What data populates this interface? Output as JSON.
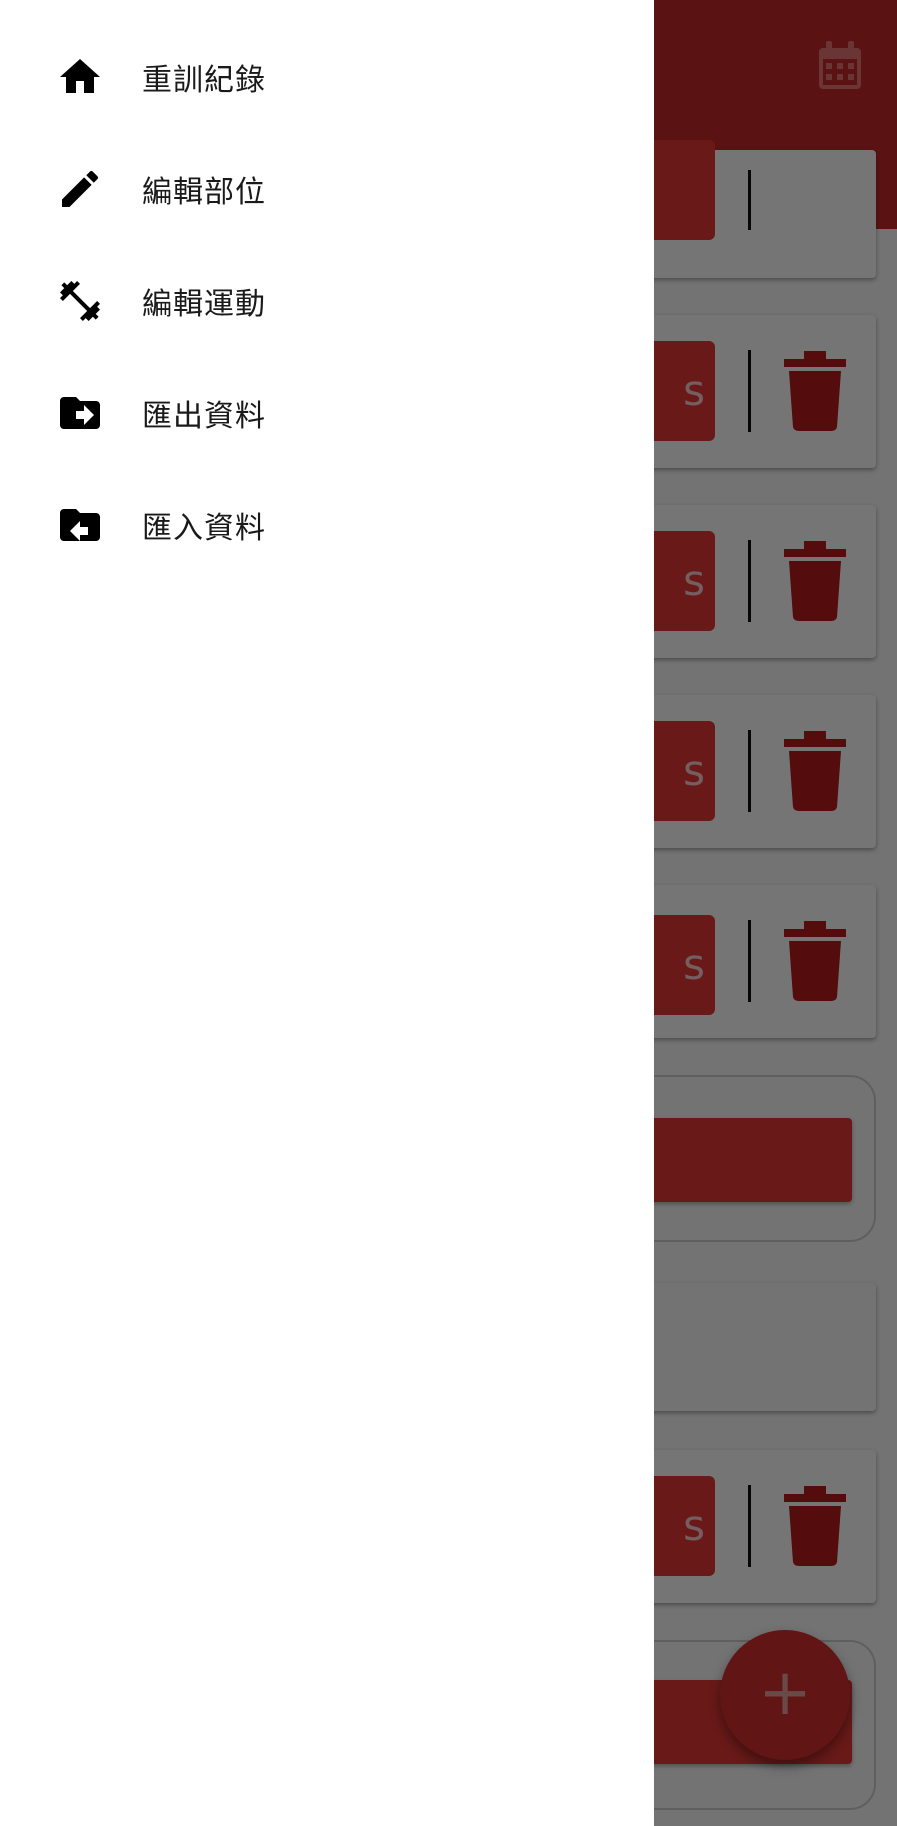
{
  "drawer": {
    "items": [
      {
        "label": "重訓紀錄",
        "icon": "home-icon"
      },
      {
        "label": "編輯部位",
        "icon": "pencil-icon"
      },
      {
        "label": "編輯運動",
        "icon": "dumbbell-icon"
      },
      {
        "label": "匯出資料",
        "icon": "folder-export-icon"
      },
      {
        "label": "匯入資料",
        "icon": "folder-import-icon"
      }
    ]
  },
  "background": {
    "set_button_partial_text": "s",
    "fab_label": "+",
    "icons": [
      "calendar-icon",
      "chevron-right-icon",
      "trash-icon",
      "plus-icon"
    ]
  },
  "colors": {
    "primary": "#c62828",
    "button": "#e53935",
    "drawer_bg": "#ffffff",
    "scrim": "rgba(0,0,0,0.54)"
  }
}
